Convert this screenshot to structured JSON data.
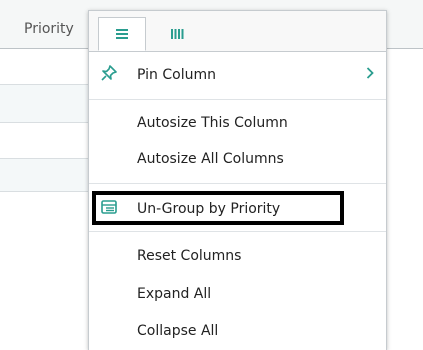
{
  "grid": {
    "header_label": "Priority"
  },
  "menu": {
    "tabs": [
      {
        "name": "general-menu-tab",
        "icon": "hamburger-icon",
        "active": true
      },
      {
        "name": "columns-tab",
        "icon": "columns-icon",
        "active": false
      }
    ],
    "items": {
      "pin_column": "Pin Column",
      "autosize_this": "Autosize This Column",
      "autosize_all": "Autosize All Columns",
      "ungroup": "Un-Group by Priority",
      "reset_columns": "Reset Columns",
      "expand_all": "Expand All",
      "collapse_all": "Collapse All"
    },
    "colors": {
      "accent": "#2a9d8f",
      "highlight_border": "#000000"
    }
  }
}
